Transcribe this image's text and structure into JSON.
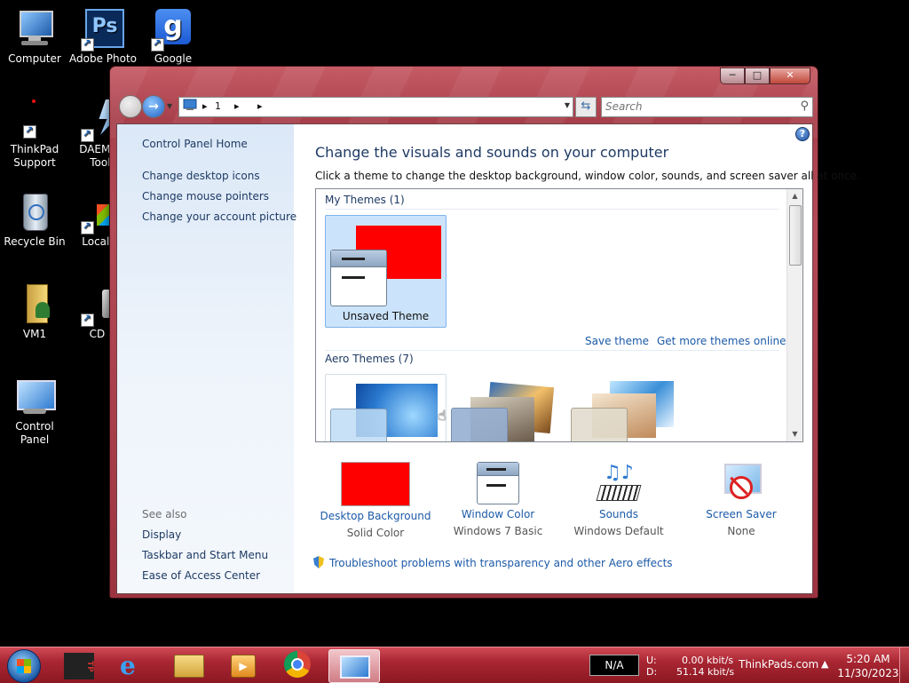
{
  "desktop": {
    "icons": [
      {
        "label": "Computer"
      },
      {
        "label": "Adobe Photo"
      },
      {
        "label": "Google"
      },
      {
        "label": "ThinkPad Support"
      },
      {
        "label": "DAEMON Tools"
      },
      {
        "label": "Recycle Bin"
      },
      {
        "label": "Local Di"
      },
      {
        "label": "VM1"
      },
      {
        "label": "CD D"
      },
      {
        "label": "Control Panel"
      }
    ]
  },
  "window": {
    "address": {
      "segment": "1"
    },
    "search": {
      "placeholder": "Search"
    },
    "sidebar": {
      "home": "Control Panel Home",
      "links": [
        "Change desktop icons",
        "Change mouse pointers",
        "Change your account picture"
      ],
      "see_also_label": "See also",
      "see_also": [
        "Display",
        "Taskbar and Start Menu",
        "Ease of Access Center"
      ]
    },
    "main": {
      "title": "Change the visuals and sounds on your computer",
      "subtitle": "Click a theme to change the desktop background, window color, sounds, and screen saver all at once.",
      "my_themes_label": "My Themes (1)",
      "unsaved_theme": "Unsaved Theme",
      "save_theme": "Save theme",
      "get_more_themes": "Get more themes online",
      "aero_themes_label": "Aero Themes (7)",
      "options": [
        {
          "label": "Desktop Background",
          "value": "Solid Color"
        },
        {
          "label": "Window Color",
          "value": "Windows 7 Basic"
        },
        {
          "label": "Sounds",
          "value": "Windows Default"
        },
        {
          "label": "Screen Saver",
          "value": "None"
        }
      ],
      "troubleshoot": "Troubleshoot problems with transparency and other Aero effects"
    }
  },
  "taskbar": {
    "indicator": "N/A",
    "net_up_label": "U:",
    "net_down_label": "D:",
    "net_up": "0.00 kbit/s",
    "net_down": "51.14 kbit/s",
    "site": "ThinkPads.com",
    "time": "5:20 AM",
    "date": "11/30/2023"
  },
  "colors": {
    "solid_background": "#ff0000",
    "accent": "#1c5aa8"
  }
}
